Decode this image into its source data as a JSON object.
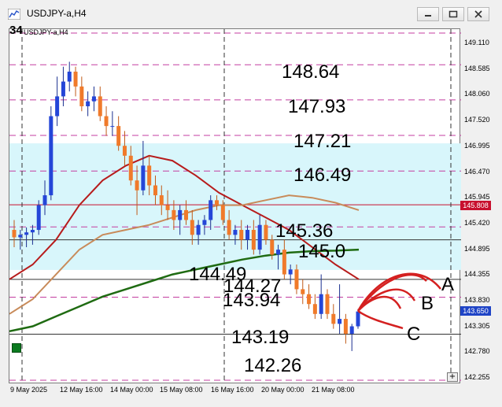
{
  "window": {
    "title": "USDJPY-a,H4",
    "chart_label": "USDJPY-a,H4",
    "corner_number": "34",
    "buttons": [
      "minimize",
      "restore",
      "close"
    ]
  },
  "price_scale": {
    "labels": [
      "149.110",
      "148.585",
      "148.060",
      "147.520",
      "146.995",
      "146.470",
      "145.945",
      "145.420",
      "144.895",
      "144.355",
      "143.830",
      "143.305",
      "142.780",
      "142.255"
    ],
    "tags": [
      {
        "text": "145.808",
        "bg": "#c8102e",
        "fg": "#ffffff"
      },
      {
        "text": "143.650",
        "bg": "#1f44c6",
        "fg": "#ffffff"
      }
    ]
  },
  "time_scale": {
    "labels": [
      "9 May 2025",
      "12 May 16:00",
      "14 May 00:00",
      "15 May 08:00",
      "16 May 16:00",
      "20 May 00:00",
      "21 May 08:00"
    ]
  },
  "annotations": {
    "levels": [
      "148.64",
      "147.93",
      "147.21",
      "146.49",
      "145.36",
      "145.0",
      "144.49",
      "144.27",
      "143.94",
      "143.19",
      "142.26"
    ],
    "scenarios": [
      "A",
      "B",
      "C"
    ]
  },
  "colors": {
    "zone_fill": "#d8f6fb",
    "bull_candle": "#2546d8",
    "bear_candle": "#f07a2a",
    "ma_fast": "#b71c1c",
    "ma_mid": "#c88b5a",
    "ma_slow": "#1f6b12",
    "dashed_level": "#c43ea0",
    "arrows": "#d42020"
  },
  "chart_data": {
    "type": "candlestick",
    "symbol": "USDJPY-a",
    "timeframe": "H4",
    "ylim": [
      142.18,
      149.36
    ],
    "candles": [
      [
        145.3,
        145.5,
        144.95,
        145.15
      ],
      [
        145.15,
        145.3,
        144.9,
        145.2
      ],
      [
        145.2,
        145.35,
        144.95,
        145.25
      ],
      [
        145.25,
        145.4,
        145.0,
        145.3
      ],
      [
        145.3,
        145.9,
        145.2,
        145.8
      ],
      [
        145.8,
        146.3,
        145.6,
        146.0
      ],
      [
        146.0,
        147.8,
        145.9,
        147.6
      ],
      [
        147.6,
        148.4,
        147.4,
        148.0
      ],
      [
        148.0,
        148.6,
        147.8,
        148.3
      ],
      [
        148.3,
        148.7,
        148.1,
        148.5
      ],
      [
        148.5,
        148.6,
        148.0,
        148.2
      ],
      [
        148.2,
        148.4,
        147.7,
        147.8
      ],
      [
        147.8,
        148.1,
        147.6,
        147.9
      ],
      [
        147.9,
        148.2,
        147.7,
        148.0
      ],
      [
        148.0,
        148.2,
        147.5,
        147.6
      ],
      [
        147.6,
        147.8,
        147.2,
        147.4
      ],
      [
        147.4,
        147.7,
        147.2,
        147.4
      ],
      [
        147.4,
        147.6,
        146.9,
        147.0
      ],
      [
        147.0,
        147.3,
        146.6,
        146.8
      ],
      [
        146.8,
        147.0,
        146.2,
        146.3
      ],
      [
        146.3,
        146.6,
        145.6,
        146.1
      ],
      [
        146.1,
        147.1,
        146.0,
        146.6
      ],
      [
        146.6,
        146.8,
        146.0,
        146.2
      ],
      [
        146.2,
        146.4,
        145.8,
        146.0
      ],
      [
        146.0,
        146.2,
        145.6,
        145.8
      ],
      [
        145.8,
        146.1,
        145.5,
        145.7
      ],
      [
        145.7,
        145.9,
        145.3,
        145.5
      ],
      [
        145.5,
        145.8,
        145.2,
        145.7
      ],
      [
        145.7,
        145.9,
        145.4,
        145.5
      ],
      [
        145.5,
        145.7,
        145.0,
        145.2
      ],
      [
        145.2,
        145.5,
        145.0,
        145.4
      ],
      [
        145.4,
        145.6,
        145.2,
        145.5
      ],
      [
        145.5,
        146.0,
        145.3,
        145.9
      ],
      [
        145.9,
        146.0,
        145.7,
        145.8
      ],
      [
        145.8,
        145.9,
        145.4,
        145.5
      ],
      [
        145.5,
        145.7,
        145.1,
        145.2
      ],
      [
        145.2,
        145.4,
        145.0,
        145.3
      ],
      [
        145.3,
        145.5,
        144.9,
        145.1
      ],
      [
        145.1,
        145.4,
        144.9,
        145.3
      ],
      [
        145.3,
        145.5,
        144.8,
        144.9
      ],
      [
        144.9,
        145.6,
        144.8,
        145.4
      ],
      [
        145.4,
        145.5,
        145.0,
        145.1
      ],
      [
        145.1,
        145.2,
        144.7,
        144.8
      ],
      [
        144.8,
        145.0,
        144.5,
        144.9
      ],
      [
        144.9,
        145.1,
        144.3,
        144.4
      ],
      [
        144.4,
        144.6,
        144.2,
        144.5
      ],
      [
        144.5,
        144.6,
        144.0,
        144.1
      ],
      [
        144.1,
        144.3,
        143.8,
        144.0
      ],
      [
        144.0,
        144.2,
        143.7,
        143.8
      ],
      [
        143.8,
        144.0,
        143.5,
        143.6
      ],
      [
        143.6,
        144.4,
        143.5,
        144.0
      ],
      [
        144.0,
        144.1,
        143.5,
        143.6
      ],
      [
        143.6,
        143.8,
        143.3,
        143.4
      ],
      [
        143.4,
        144.2,
        143.2,
        143.5
      ],
      [
        143.5,
        143.6,
        143.0,
        143.2
      ],
      [
        143.2,
        143.4,
        142.85,
        143.35
      ],
      [
        143.35,
        143.7,
        143.3,
        143.65
      ]
    ],
    "moving_averages": [
      {
        "name": "fast",
        "values": [
          144.3,
          144.6,
          145.1,
          145.8,
          146.3,
          146.6,
          146.8,
          146.7,
          146.4,
          146.05,
          145.8,
          145.55,
          145.3,
          144.95,
          144.6,
          144.3
        ]
      },
      {
        "name": "medium",
        "values": [
          143.6,
          143.9,
          144.4,
          144.9,
          145.2,
          145.3,
          145.4,
          145.55,
          145.7,
          145.8,
          145.8,
          145.9,
          146.0,
          145.95,
          145.85,
          145.7
        ]
      },
      {
        "name": "slow",
        "values": [
          143.25,
          143.35,
          143.55,
          143.75,
          143.95,
          144.1,
          144.25,
          144.4,
          144.5,
          144.6,
          144.7,
          144.78,
          144.84,
          144.87,
          144.88,
          144.9
        ]
      }
    ],
    "horizontal_lines": [
      {
        "price": 145.808,
        "style": "solid",
        "color": "#c8102e"
      },
      {
        "price": 145.1,
        "style": "solid",
        "color": "#333333"
      },
      {
        "price": 144.3,
        "style": "solid",
        "color": "#333333"
      },
      {
        "price": 143.19,
        "style": "solid",
        "color": "#333333"
      },
      {
        "price": 149.28,
        "style": "dashed"
      },
      {
        "price": 148.64,
        "style": "dashed"
      },
      {
        "price": 147.93,
        "style": "dashed"
      },
      {
        "price": 147.21,
        "style": "dashed"
      },
      {
        "price": 146.49,
        "style": "dashed"
      },
      {
        "price": 145.36,
        "style": "dashed"
      },
      {
        "price": 143.94,
        "style": "dashed"
      },
      {
        "price": 142.26,
        "style": "dashed"
      }
    ],
    "zone": {
      "from": 144.49,
      "to": 147.05
    },
    "grid": false
  }
}
